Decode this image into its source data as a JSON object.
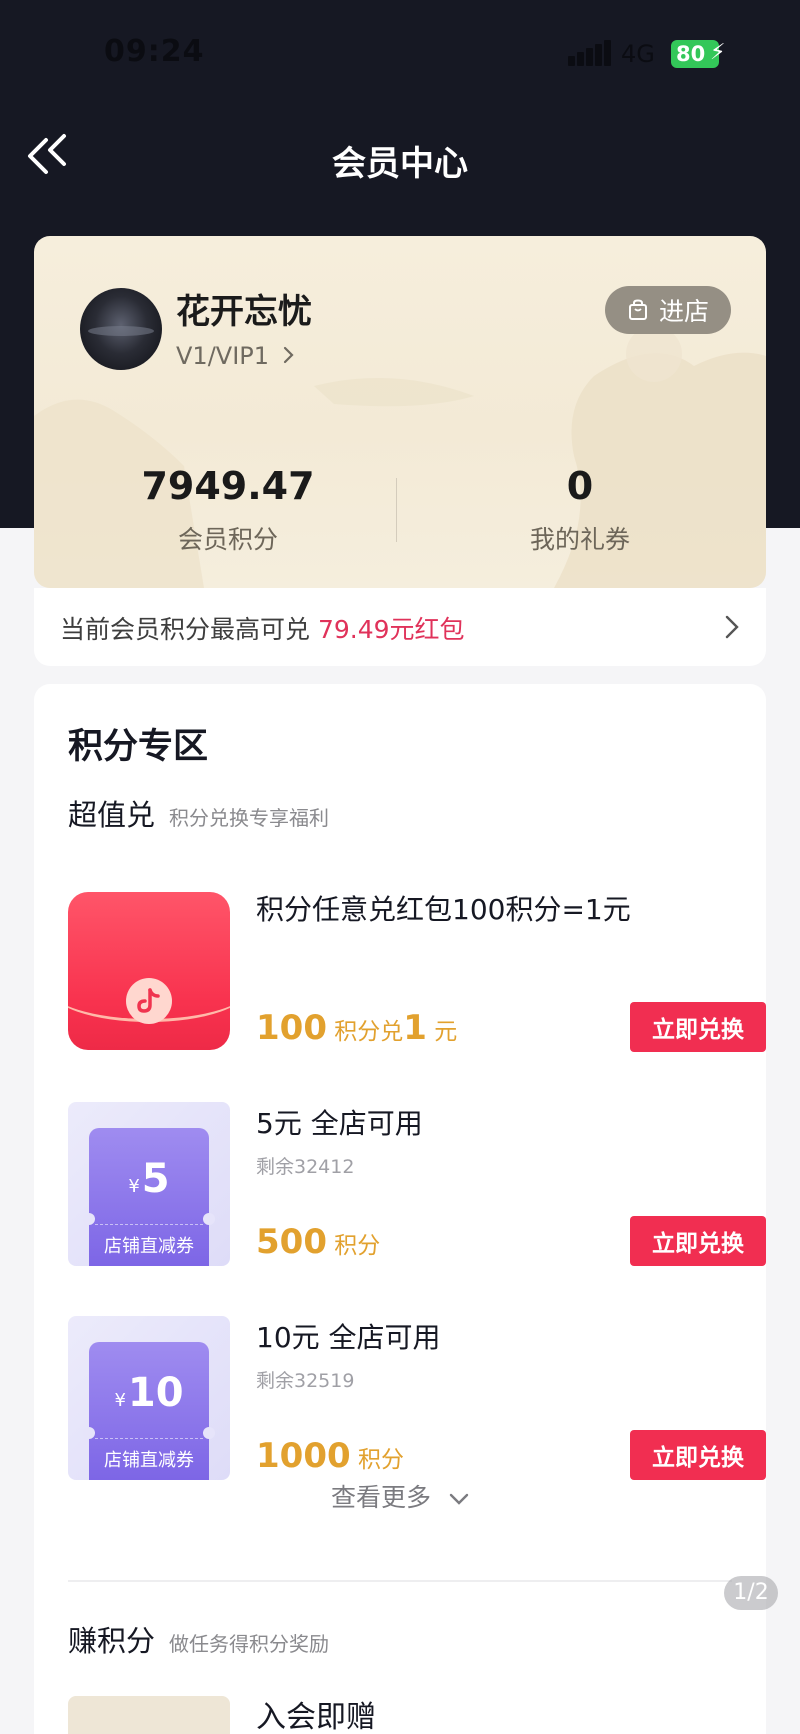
{
  "status_bar": {
    "time": "09:24",
    "network": "4G",
    "battery": "80"
  },
  "nav": {
    "title": "会员中心"
  },
  "member": {
    "name": "花开忘忧",
    "level": "V1/VIP1",
    "enter_store_label": "进店",
    "points_value": "7949.47",
    "points_label": "会员积分",
    "coupons_value": "0",
    "coupons_label": "我的礼券"
  },
  "redeem_tip": {
    "prefix": "当前会员积分最高可兑",
    "highlight": "79.49元红包"
  },
  "points_zone": {
    "title": "积分专区",
    "super_value": {
      "title": "超值兑",
      "subtitle": "积分兑换专享福利"
    },
    "items": [
      {
        "title": "积分任意兑红包100积分=1元",
        "remaining": "",
        "price_num": "100",
        "price_unit": "积分兑",
        "price_num2": "1",
        "price_unit2": "元",
        "button": "立即兑换"
      },
      {
        "title": "5元 全店可用",
        "remaining": "剩余32412",
        "coupon_amount": "5",
        "coupon_yen": "¥",
        "coupon_label": "店铺直减券",
        "price_num": "500",
        "price_unit": "积分",
        "button": "立即兑换"
      },
      {
        "title": "10元 全店可用",
        "remaining": "剩余32519",
        "coupon_amount": "10",
        "coupon_yen": "¥",
        "coupon_label": "店铺直减券",
        "price_num": "1000",
        "price_unit": "积分",
        "button": "立即兑换"
      }
    ],
    "see_more": "查看更多",
    "earn": {
      "title": "赚积分",
      "subtitle": "做任务得积分奖励",
      "first_item_title": "入会即赠"
    }
  },
  "page_indicator": "1/2",
  "colors": {
    "header_bg": "#161823",
    "accent_red": "#f12e51",
    "price_gold": "#e2a12e",
    "highlight": "#e0325a"
  }
}
